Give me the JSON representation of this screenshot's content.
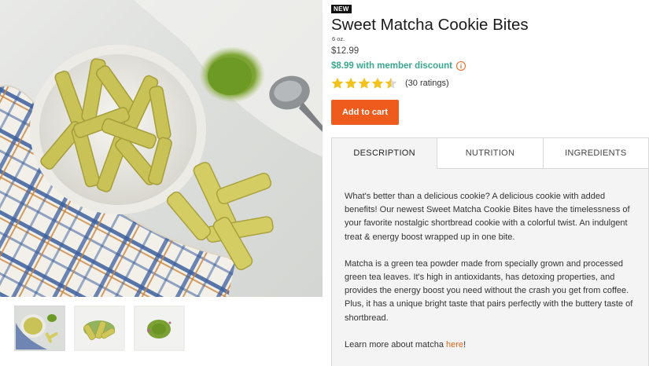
{
  "product": {
    "badge": "NEW",
    "title": "Sweet Matcha Cookie Bites",
    "size": "6 oz.",
    "price": "$12.99",
    "member_price": "$8.99 with member discount",
    "rating": 4.5,
    "rating_count": "(30 ratings)",
    "add_to_cart": "Add to cart"
  },
  "tabs": [
    {
      "label": "DESCRIPTION",
      "active": true
    },
    {
      "label": "NUTRITION",
      "active": false
    },
    {
      "label": "INGREDIENTS",
      "active": false
    }
  ],
  "description": {
    "p1": "What's better than a delicious cookie? A delicious cookie with added benefits! Our newest Sweet Matcha Cookie Bites have the timelessness of your favorite nostalgic shortbread cookie with a colorful twist. An indulgent treat & energy boost wrapped up in one bite.",
    "p2": "Matcha is a green tea powder made from specially grown and processed green tea leaves. It's high in antioxidants, has detoxing properties, and provides the energy boost you need without the crash you get from coffee. Plus, it has a unique bright taste that pairs perfectly with the buttery taste of shortbread.",
    "p3_prefix": "Learn more about matcha ",
    "p3_link": "here",
    "p3_suffix": "!"
  },
  "colors": {
    "accent_orange": "#ee5b1c",
    "member_green": "#3aa78f",
    "star_gold": "#f3c21c"
  },
  "icons": [
    "info-icon",
    "star-icon"
  ]
}
